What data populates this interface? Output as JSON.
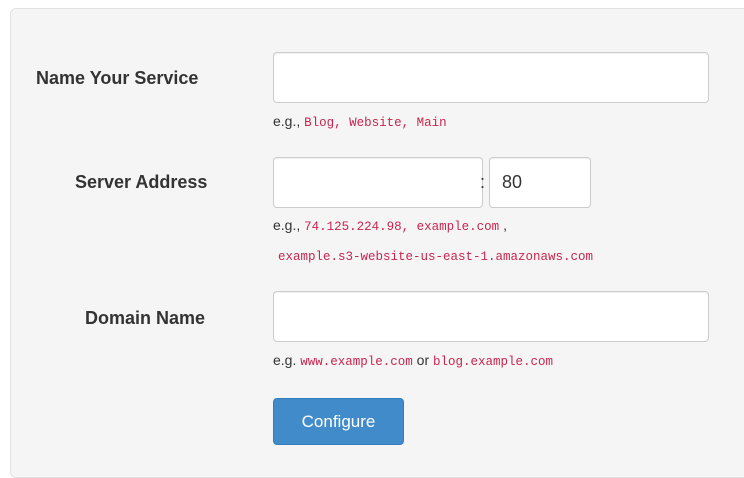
{
  "form": {
    "service_name": {
      "label": "Name Your Service",
      "value": "",
      "help_prefix": "e.g.,",
      "help_examples": "Blog, Website, Main"
    },
    "server_address": {
      "label": "Server Address",
      "host_value": "",
      "separator": ":",
      "port_value": "80",
      "help_prefix": "e.g.,",
      "help_examples_1": "74.125.224.98, example.com",
      "help_comma": ",",
      "help_examples_2": "example.s3-website-us-east-1.amazonaws.com"
    },
    "domain_name": {
      "label": "Domain Name",
      "value": "",
      "help_prefix": "e.g.",
      "help_example_1": "www.example.com",
      "help_or": "or",
      "help_example_2": "blog.example.com"
    },
    "submit_label": "Configure"
  },
  "colors": {
    "panel_bg": "#f5f5f5",
    "code_text": "#c7254e",
    "button_bg": "#428bca",
    "button_text": "#ffffff"
  }
}
